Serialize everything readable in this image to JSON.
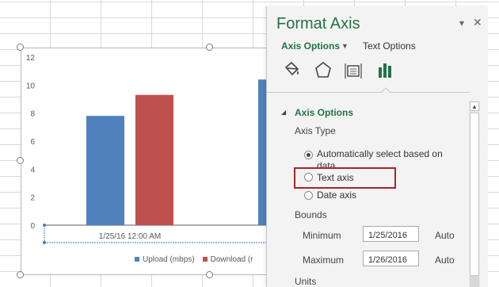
{
  "chart": {
    "legend": [
      {
        "label": "Upload (mbps)",
        "color": "#4f81bd"
      },
      {
        "label": "Download (r",
        "color": "#c0504d"
      }
    ]
  },
  "chart_data": {
    "type": "bar",
    "categories": [
      "1/25/16 12:00 AM",
      ""
    ],
    "series": [
      {
        "name": "Upload (mbps)",
        "values": [
          7.8,
          10.4
        ],
        "color": "#4f81bd"
      },
      {
        "name": "Download (r",
        "values": [
          9.3,
          null
        ],
        "color": "#c0504d"
      }
    ],
    "ylim": [
      0,
      12
    ],
    "yticks": [
      0,
      2,
      4,
      6,
      8,
      10,
      12
    ],
    "grid": false,
    "legend_position": "bottom"
  },
  "pane": {
    "title": "Format Axis",
    "collapse_glyph": "▾",
    "close_glyph": "✕",
    "tabs": {
      "active": "Axis Options",
      "caret": "▼",
      "other": "Text Options"
    },
    "icons": [
      "paint-bucket-icon",
      "pentagon-icon",
      "size-properties-icon",
      "bar-chart-icon"
    ],
    "section_toggle": "◢",
    "section_title": "Axis Options",
    "axis_type_label": "Axis Type",
    "axis_type_options": [
      {
        "line1": "Automatically select based on",
        "line2": "data",
        "checked": true
      },
      {
        "line1": "Text axis",
        "line2": "",
        "checked": false
      },
      {
        "line1": "Date axis",
        "line2": "",
        "checked": false
      }
    ],
    "bounds_label": "Bounds",
    "bounds": {
      "minimum_label": "Minimum",
      "minimum_value": "1/25/2016",
      "minimum_auto": "Auto",
      "maximum_label": "Maximum",
      "maximum_value": "1/26/2016",
      "maximum_auto": "Auto"
    },
    "units_label": "Units",
    "scroll_up_glyph": "▲",
    "accent_color": "#217346",
    "highlight_color": "#a5262b"
  }
}
